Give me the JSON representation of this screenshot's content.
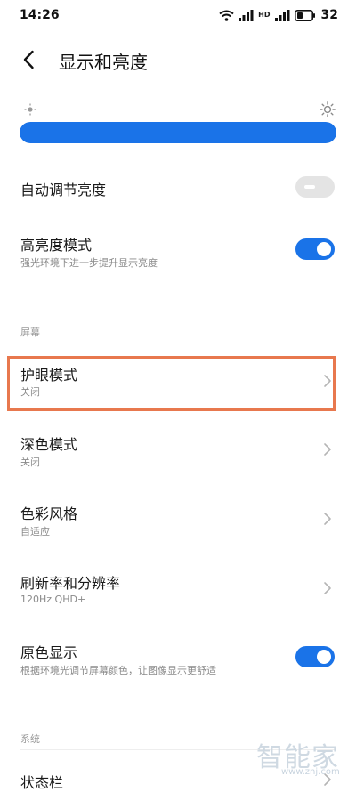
{
  "status_bar": {
    "time": "14:26",
    "battery": "32",
    "hd_label": "HD"
  },
  "header": {
    "title": "显示和亮度",
    "back_icon": "chevron-left-icon"
  },
  "brightness": {
    "level_fraction": 1.0,
    "low_icon": "sun-small-icon",
    "high_icon": "sun-large-icon"
  },
  "settings": {
    "auto_brightness": {
      "title": "自动调节亮度",
      "enabled": false
    },
    "high_brightness": {
      "title": "高亮度模式",
      "subtitle": "强光环境下进一步提升显示亮度",
      "enabled": true
    },
    "screen_section_label": "屏幕",
    "eye_protection": {
      "title": "护眼模式",
      "subtitle": "关闭"
    },
    "dark_mode": {
      "title": "深色模式",
      "subtitle": "关闭"
    },
    "color_style": {
      "title": "色彩风格",
      "subtitle": "自适应"
    },
    "refresh_rate": {
      "title": "刷新率和分辨率",
      "subtitle": "120Hz  QHD+"
    },
    "true_tone": {
      "title": "原色显示",
      "subtitle": "根据环境光调节屏幕颜色，让图像显示更舒适",
      "enabled": true
    },
    "system_section_label": "系统",
    "status_bar_item": {
      "title": "状态栏"
    }
  },
  "watermark": {
    "text": "智能家",
    "url": "www.znj.com"
  },
  "colors": {
    "accent": "#1a73e8",
    "highlight_border": "#e8784e",
    "toggle_off": "#e4e4e4"
  }
}
